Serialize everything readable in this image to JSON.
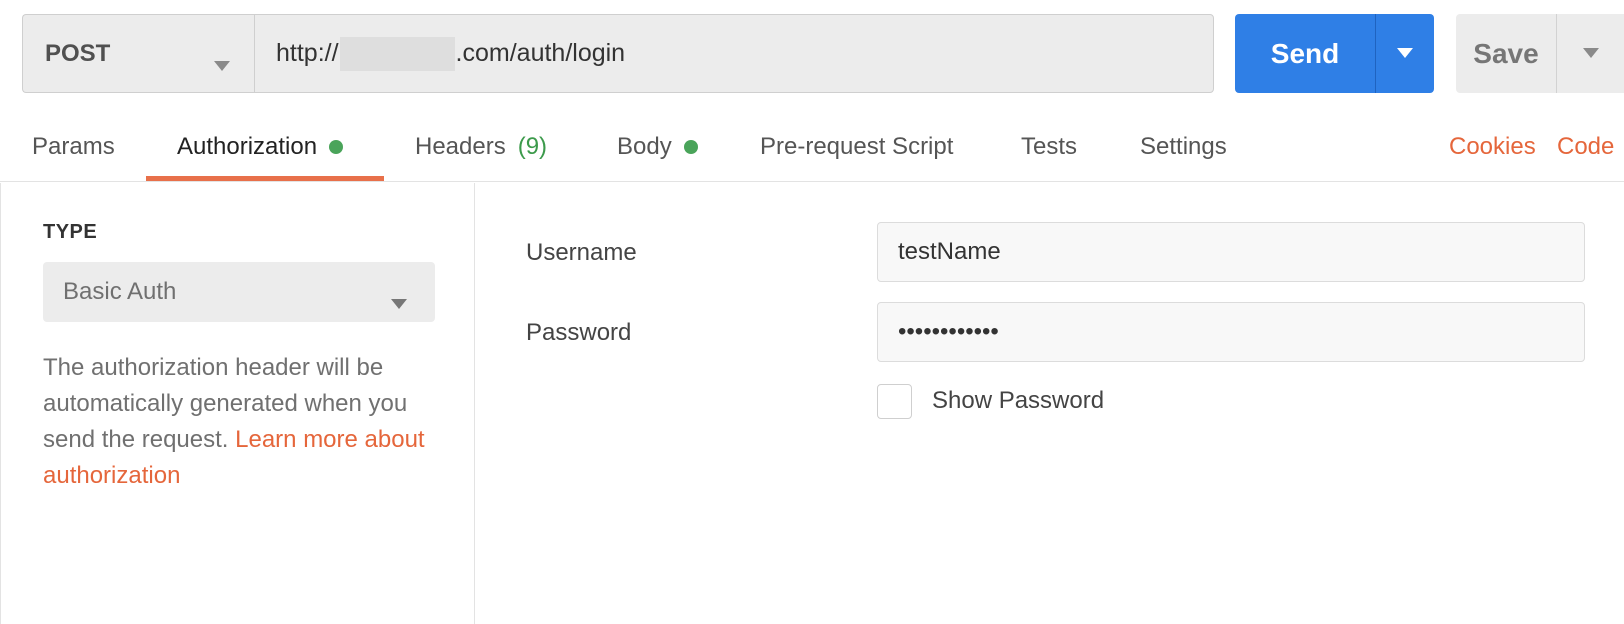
{
  "request": {
    "method": "POST",
    "url_prefix": "http://",
    "url_suffix": ".com/auth/login"
  },
  "actions": {
    "send_label": "Send",
    "save_label": "Save"
  },
  "tabs": {
    "params": "Params",
    "authorization": "Authorization",
    "headers": "Headers",
    "headers_count": "(9)",
    "body": "Body",
    "prerequest": "Pre-request Script",
    "tests": "Tests",
    "settings": "Settings",
    "cookies": "Cookies",
    "code": "Code"
  },
  "auth": {
    "type_label": "TYPE",
    "type_value": "Basic Auth",
    "description": "The authorization header will be automatically generated when you send the request.",
    "learn_more": "Learn more about authorization"
  },
  "form": {
    "username_label": "Username",
    "username_value": "testName",
    "password_label": "Password",
    "password_value": "••••••••••••",
    "show_password_label": "Show Password",
    "show_password_checked": false
  },
  "colors": {
    "accent": "#e8704a",
    "send_blue": "#2f7fe6",
    "status_green": "#4aa45a",
    "link_orange": "#e5663b"
  }
}
